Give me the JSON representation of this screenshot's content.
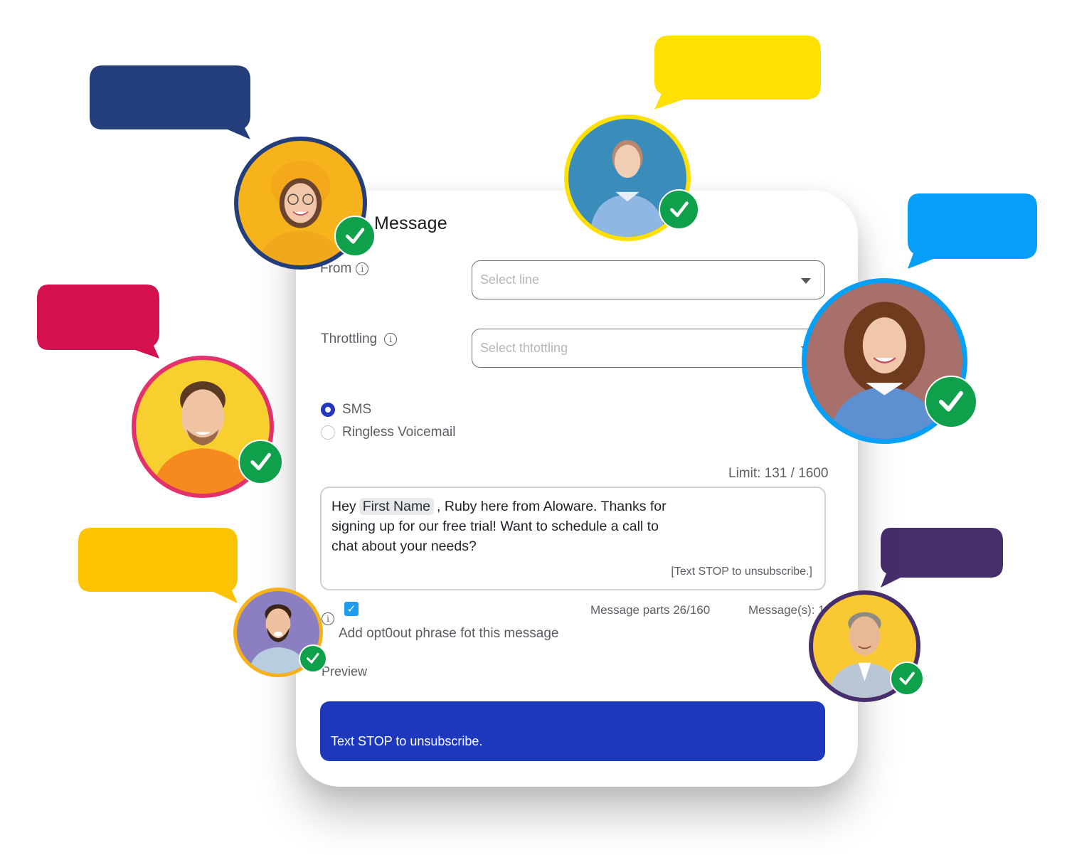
{
  "card": {
    "title": "Message",
    "from": {
      "label": "From",
      "placeholder": "Select line"
    },
    "throttling": {
      "label": "Throttling",
      "placeholder": "Select thtottling"
    },
    "channels": [
      {
        "label": "SMS",
        "selected": true
      },
      {
        "label": "Ringless Voicemail",
        "selected": false
      }
    ],
    "limit": "Limit: 131 / 1600",
    "message": {
      "greeting": "Hey",
      "variable_chip": "First Name",
      "body": ", Ruby here from Aloware. Thanks for signing up for our free trial! Want to schedule a call to chat about your needs?",
      "optout_tag": "[Text STOP to unsubscribe.]"
    },
    "optout_checkbox": {
      "checked": true,
      "label": "Add opt0out phrase fot this message"
    },
    "message_parts": "Message parts 26/160",
    "messages_count": "Message(s): 1",
    "preview": {
      "label": "Preview",
      "text": "Text STOP to unsubscribe."
    }
  },
  "decorations": {
    "check_icon_color": "#0ea04b",
    "contacts": [
      {
        "name": "contact-glasses-woman",
        "ring_color": "#243e7c",
        "bubble_color": "#243e7c",
        "bg_color": "#f6b31b",
        "verified": true
      },
      {
        "name": "contact-teen-girl",
        "ring_color": "#ffe000",
        "bubble_color": "#ffe000",
        "bg_color": "#3a8dbb",
        "verified": true
      },
      {
        "name": "contact-curly-woman",
        "ring_color": "#059ff7",
        "bubble_color": "#059ff7",
        "bg_color": "#a8706a",
        "verified": true
      },
      {
        "name": "contact-hoodie-man",
        "ring_color": "#e3316a",
        "bubble_color": "#d4104f",
        "bg_color": "#f7cf2f",
        "verified": true
      },
      {
        "name": "contact-bearded-man",
        "ring_color": "#f8b219",
        "bubble_color": "#fcc300",
        "bg_color": "#8b7fc1",
        "verified": true
      },
      {
        "name": "contact-grey-hair-man",
        "ring_color": "#462e6d",
        "bubble_color": "#462e6d",
        "bg_color": "#f9c934",
        "verified": true
      }
    ]
  }
}
